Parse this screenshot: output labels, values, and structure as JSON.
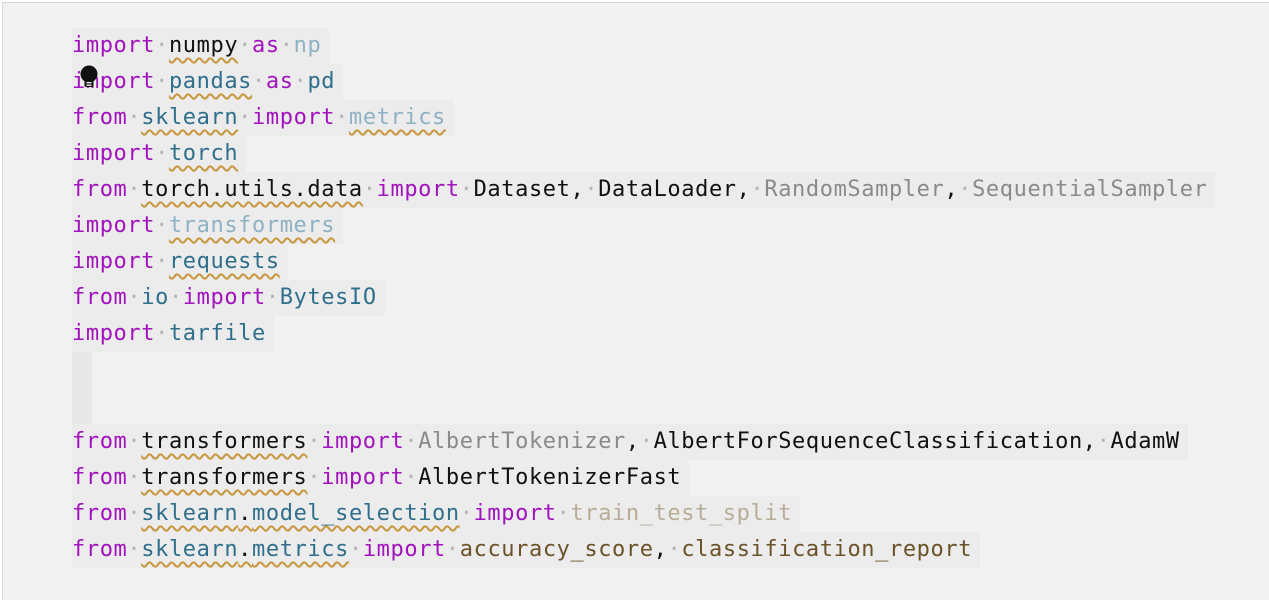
{
  "code_lines": [
    [
      {
        "t": "import",
        "c": "kw"
      },
      {
        "t": "·",
        "c": "ws"
      },
      {
        "t": "numpy",
        "c": "plain",
        "u": true
      },
      {
        "t": "·",
        "c": "ws"
      },
      {
        "t": "as",
        "c": "kw"
      },
      {
        "t": "·",
        "c": "ws"
      },
      {
        "t": "np",
        "c": "faded"
      }
    ],
    [
      {
        "t": "import",
        "c": "kw"
      },
      {
        "t": "·",
        "c": "ws"
      },
      {
        "t": "pandas",
        "c": "mod",
        "u": true
      },
      {
        "t": "·",
        "c": "ws"
      },
      {
        "t": "as",
        "c": "kw"
      },
      {
        "t": "·",
        "c": "ws"
      },
      {
        "t": "pd",
        "c": "mod"
      }
    ],
    [
      {
        "t": "from",
        "c": "kw"
      },
      {
        "t": "·",
        "c": "ws"
      },
      {
        "t": "sklearn",
        "c": "mod",
        "u": true
      },
      {
        "t": "·",
        "c": "ws"
      },
      {
        "t": "import",
        "c": "kw"
      },
      {
        "t": "·",
        "c": "ws"
      },
      {
        "t": "metrics",
        "c": "faded",
        "u": true
      }
    ],
    [
      {
        "t": "import",
        "c": "kw"
      },
      {
        "t": "·",
        "c": "ws"
      },
      {
        "t": "torch",
        "c": "mod",
        "u": true
      }
    ],
    [
      {
        "t": "from",
        "c": "kw"
      },
      {
        "t": "·",
        "c": "ws"
      },
      {
        "t": "torch.utils.data",
        "c": "plain",
        "u": true
      },
      {
        "t": "·",
        "c": "ws"
      },
      {
        "t": "import",
        "c": "kw"
      },
      {
        "t": "·",
        "c": "ws"
      },
      {
        "t": "Dataset,",
        "c": "plain"
      },
      {
        "t": "·",
        "c": "ws"
      },
      {
        "t": "DataLoader,",
        "c": "plain"
      },
      {
        "t": "·",
        "c": "ws"
      },
      {
        "t": "RandomSampler",
        "c": "gray"
      },
      {
        "t": ",",
        "c": "plain"
      },
      {
        "t": "·",
        "c": "ws"
      },
      {
        "t": "SequentialSampler",
        "c": "gray"
      }
    ],
    [
      {
        "t": "import",
        "c": "kw"
      },
      {
        "t": "·",
        "c": "ws"
      },
      {
        "t": "transformers",
        "c": "faded",
        "u": true
      }
    ],
    [
      {
        "t": "import",
        "c": "kw"
      },
      {
        "t": "·",
        "c": "ws"
      },
      {
        "t": "requests",
        "c": "mod",
        "u": true
      }
    ],
    [
      {
        "t": "from",
        "c": "kw"
      },
      {
        "t": "·",
        "c": "ws"
      },
      {
        "t": "io",
        "c": "mod"
      },
      {
        "t": "·",
        "c": "ws"
      },
      {
        "t": "import",
        "c": "kw"
      },
      {
        "t": "·",
        "c": "ws"
      },
      {
        "t": "BytesIO",
        "c": "mod"
      }
    ],
    [
      {
        "t": "import",
        "c": "kw"
      },
      {
        "t": "·",
        "c": "ws"
      },
      {
        "t": "tarfile",
        "c": "mod"
      }
    ],
    [],
    [],
    [
      {
        "t": "from",
        "c": "kw"
      },
      {
        "t": "·",
        "c": "ws"
      },
      {
        "t": "transformers",
        "c": "plain",
        "u": true
      },
      {
        "t": "·",
        "c": "ws"
      },
      {
        "t": "import",
        "c": "kw"
      },
      {
        "t": "·",
        "c": "ws"
      },
      {
        "t": "AlbertTokenizer",
        "c": "gray"
      },
      {
        "t": ",",
        "c": "plain"
      },
      {
        "t": "·",
        "c": "ws"
      },
      {
        "t": "AlbertForSequenceClassification,",
        "c": "plain"
      },
      {
        "t": "·",
        "c": "ws"
      },
      {
        "t": "AdamW",
        "c": "plain"
      }
    ],
    [
      {
        "t": "from",
        "c": "kw"
      },
      {
        "t": "·",
        "c": "ws"
      },
      {
        "t": "transformers",
        "c": "plain",
        "u": true
      },
      {
        "t": "·",
        "c": "ws"
      },
      {
        "t": "import",
        "c": "kw"
      },
      {
        "t": "·",
        "c": "ws"
      },
      {
        "t": "AlbertTokenizerFast",
        "c": "plain"
      }
    ],
    [
      {
        "t": "from",
        "c": "kw"
      },
      {
        "t": "·",
        "c": "ws"
      },
      {
        "t": "sklearn",
        "c": "mod",
        "u": true
      },
      {
        "t": ".",
        "c": "plain",
        "u": true
      },
      {
        "t": "model_selection",
        "c": "mod",
        "u": true
      },
      {
        "t": "·",
        "c": "ws"
      },
      {
        "t": "import",
        "c": "kw"
      },
      {
        "t": "·",
        "c": "ws"
      },
      {
        "t": "train_test_split",
        "c": "olive"
      }
    ],
    [
      {
        "t": "from",
        "c": "kw"
      },
      {
        "t": "·",
        "c": "ws"
      },
      {
        "t": "sklearn",
        "c": "mod",
        "u": true
      },
      {
        "t": ".",
        "c": "plain",
        "u": true
      },
      {
        "t": "metrics",
        "c": "mod",
        "u": true
      },
      {
        "t": "·",
        "c": "ws"
      },
      {
        "t": "import",
        "c": "kw"
      },
      {
        "t": "·",
        "c": "ws"
      },
      {
        "t": "accuracy_score",
        "c": "brown"
      },
      {
        "t": ",",
        "c": "plain"
      },
      {
        "t": "·",
        "c": "ws"
      },
      {
        "t": "classification_report",
        "c": "brown"
      }
    ]
  ],
  "icons": {
    "lightbulb": "lightbulb-icon"
  },
  "colors": {
    "keyword": "#a212be",
    "module": "#2f6f8c",
    "plain": "#111111",
    "unused": "#8eb1c4",
    "dimmed": "#8a8a8a",
    "function": "#6b5228",
    "squiggle": "#c8963c",
    "background": "#f2f2f2"
  }
}
